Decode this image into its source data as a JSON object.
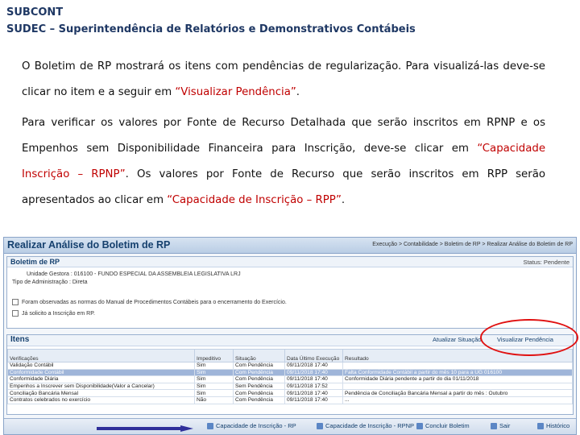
{
  "header": {
    "line1": "SUBCONT",
    "line2": "SUDEC – Superintendência de Relatórios e Demonstrativos Contábeis"
  },
  "body": {
    "p1_a": "O Boletim  de RP mostrará os itens com pendências de regularização. Para visualizá-las deve-se clicar no item e a seguir em ",
    "p1_red": "“Visualizar Pendência”",
    "p1_end": ".",
    "p2_a": "Para verificar os valores por Fonte de Recurso Detalhada que serão inscritos em  RPNP e os Empenhos sem Disponibilidade Financeira para Inscrição, deve-se clicar em ",
    "p2_red1": "“Capacidade Inscrição – RPNP”",
    "p2_b": ". Os valores por Fonte de Recurso que serão inscritos em RPP serão apresentados ao clicar em ",
    "p2_red2": "“Capacidade de Inscrição – RPP”",
    "p2_end": "."
  },
  "screenshot": {
    "title": "Realizar Análise do Boletim de RP",
    "breadcrumb": "Execução > Contabilidade > Boletim de RP > Realizar Análise do Boletim de RP",
    "panel_title": "Boletim de RP",
    "status_label": "Status: Pendente",
    "unidade": "Unidade Gestora : 016100 - FUNDO ESPECIAL DA ASSEMBLEIA LEGISLATIVA LRJ",
    "tipo": "Tipo de Administração : Direta",
    "check1": "Foram observadas as normas do Manual de Procedimentos Contábeis para o encerramento do Exercício.",
    "check2": "Já solicito a Inscrição em RP.",
    "items_title": "Itens",
    "atualizar": "Atualizar Situação",
    "visualizar": "Visualizar Pendência",
    "columns": [
      "Verificações",
      "Impeditivo",
      "Situação",
      "Data Último Execução",
      "Resultado"
    ],
    "rows": [
      [
        "Validação Contábil",
        "Sim",
        "Com Pendência",
        "09/11/2018 17:40",
        ""
      ],
      [
        "Conformidade Contábil",
        "Sim",
        "Com Pendência",
        "09/11/2018 17:40",
        "Falta Conformidade Contábil a partir do mês 10 para a UG 016100"
      ],
      [
        "Conformidade Diária",
        "Sim",
        "Com Pendência",
        "09/11/2018 17:40",
        "Conformidade Diária pendente a partir do dia 01/11/2018"
      ],
      [
        "Empenhos a Inscrever sem Disponibilidade(Valor a Cancelar)",
        "Sim",
        "Sem Pendência",
        "09/11/2018 17:52",
        ""
      ],
      [
        "Conciliação Bancária Mensal",
        "Sim",
        "Com Pendência",
        "09/11/2018 17:40",
        "Pendência de Conciliação Bancária Mensal a partir do mês : Outubro"
      ],
      [
        "Contratos celebrados no exercício",
        "Não",
        "Com Pendência",
        "09/11/2018 17:40",
        "..."
      ]
    ],
    "footer": {
      "btn_rpnp": "Capacidade de Inscrição - RP",
      "btn_rpnp2": "Capacidade de Inscrição - RPNP",
      "btn_concluir": "Concluir Boletim",
      "btn_sair": "Sair",
      "btn_historico": "Histórico"
    }
  },
  "colors": {
    "header": "#1f3864",
    "highlight": "#c00000",
    "annotation": "#e01010",
    "arrow": "#2f2f9a"
  }
}
